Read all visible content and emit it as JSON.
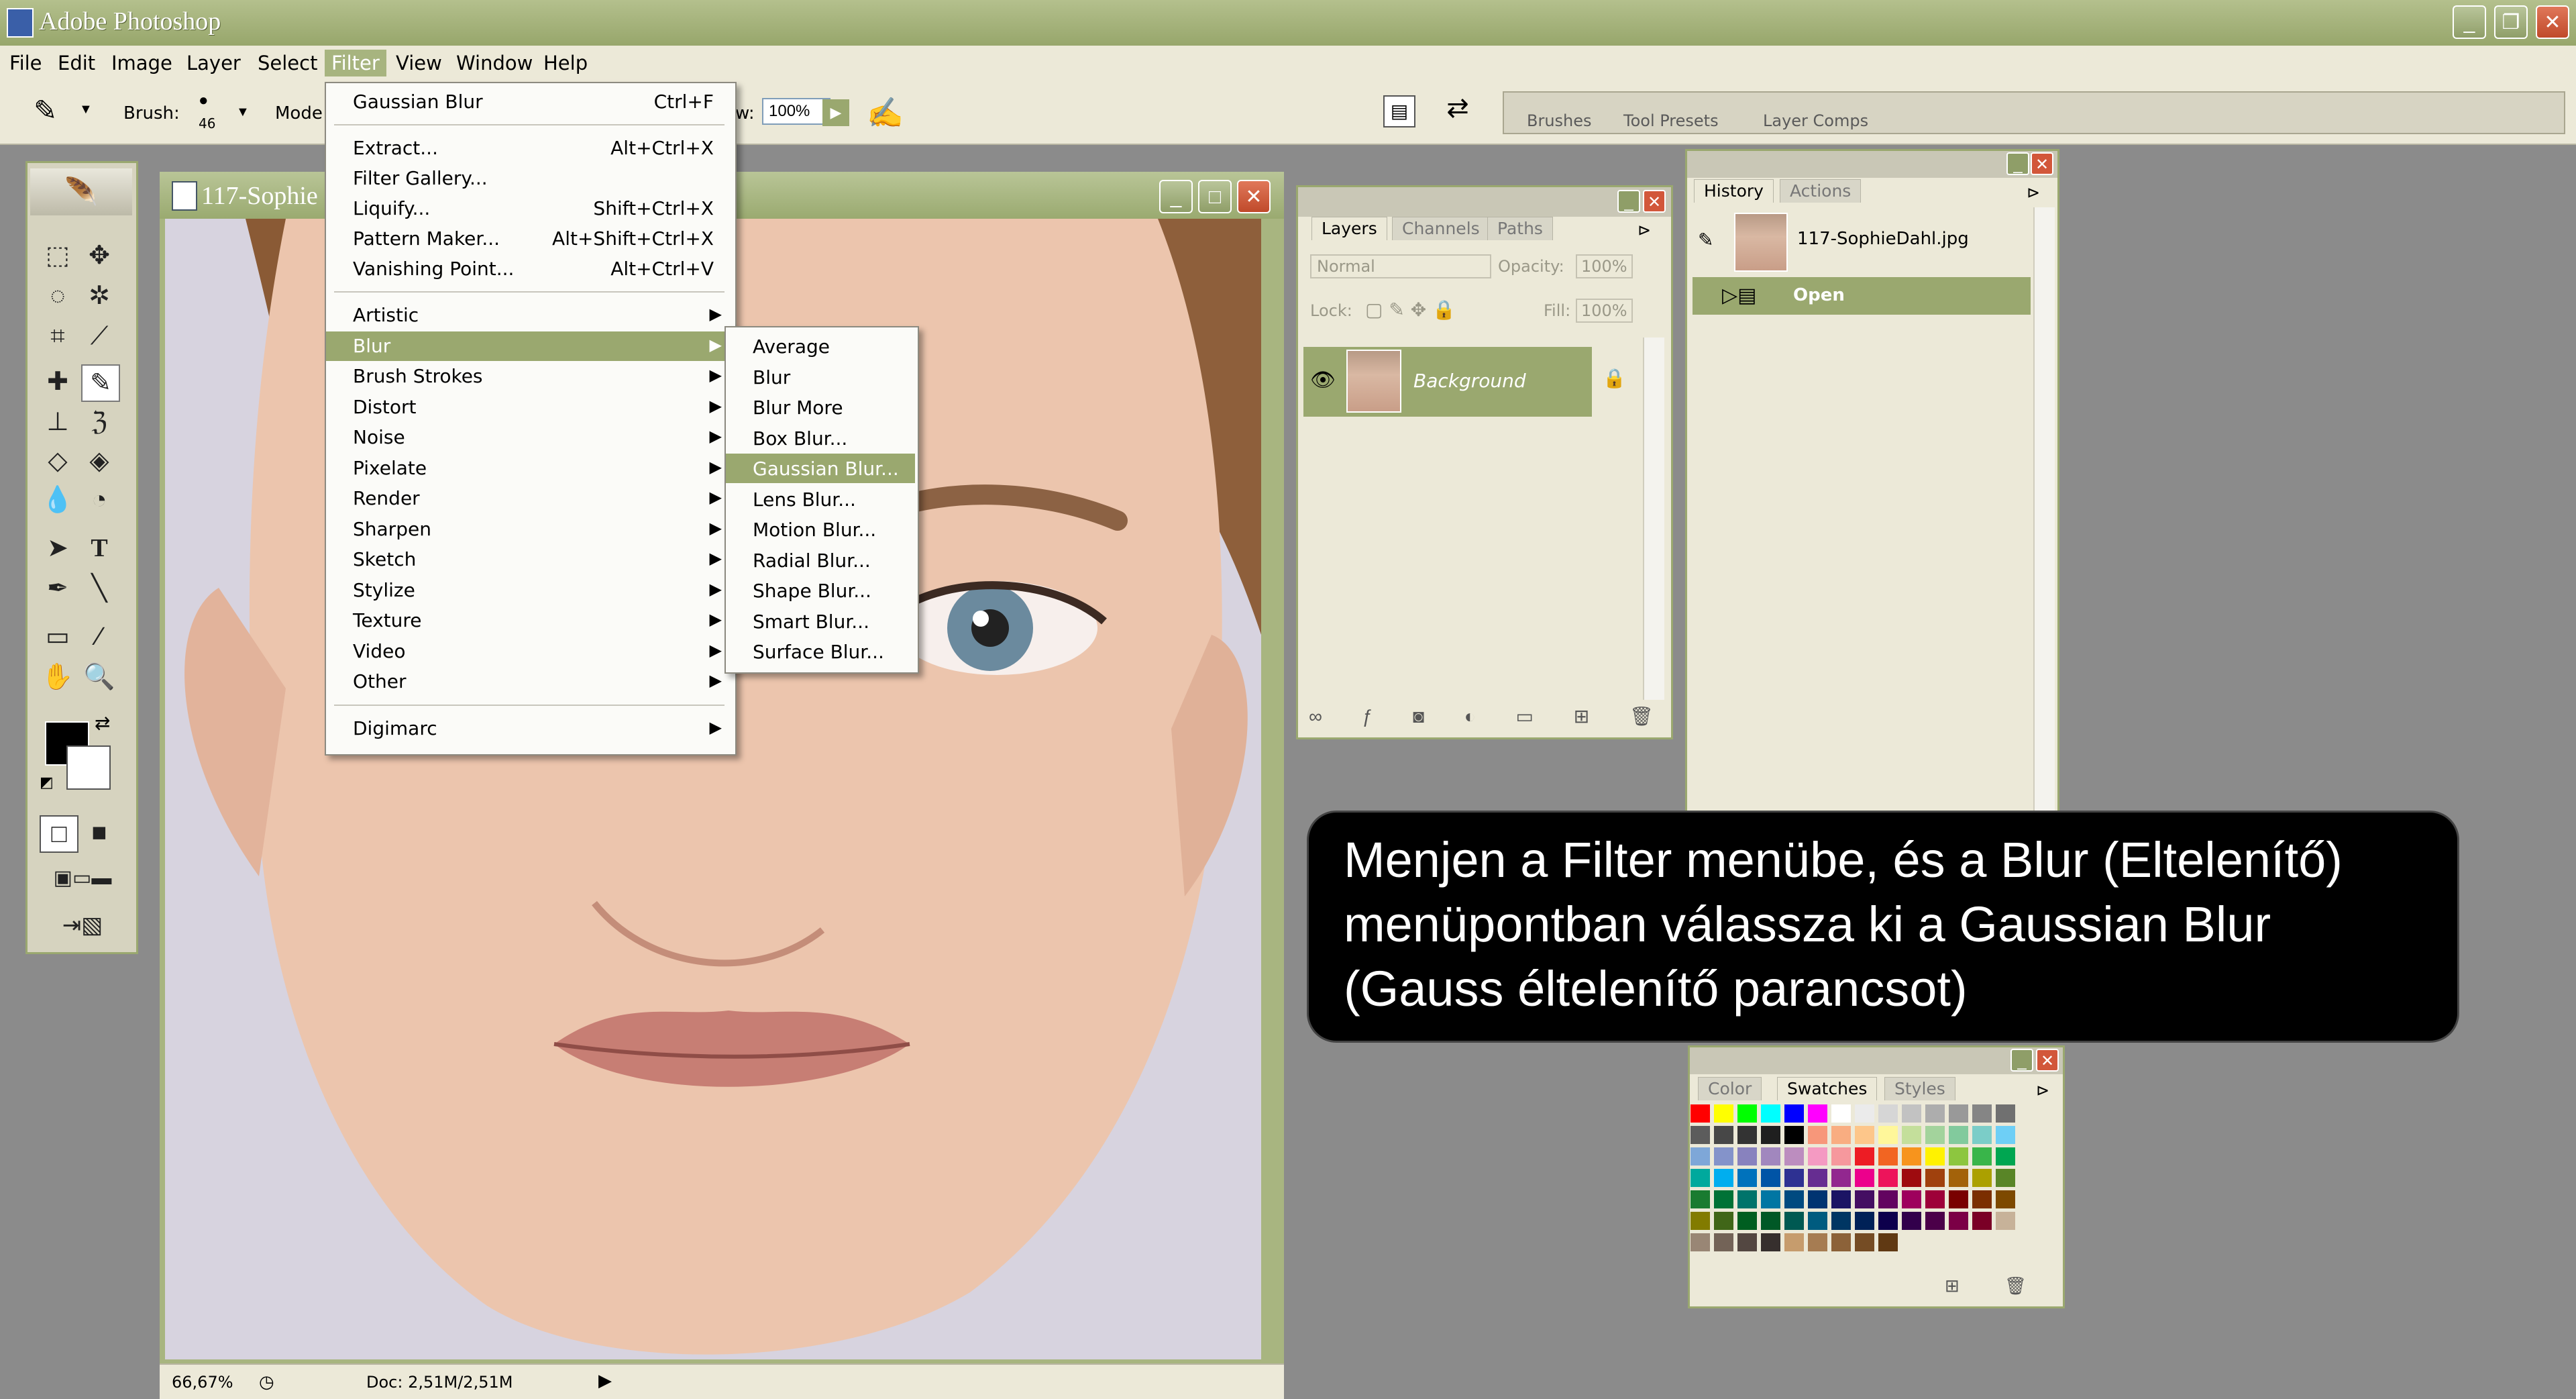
{
  "app": {
    "title": "Adobe Photoshop",
    "window_buttons": [
      "_",
      "❐",
      "✕"
    ]
  },
  "menubar": {
    "items": [
      "File",
      "Edit",
      "Image",
      "Layer",
      "Select",
      "Filter",
      "View",
      "Window",
      "Help"
    ],
    "active": "Filter"
  },
  "options_bar": {
    "brush_label": "Brush:",
    "brush_size": "46",
    "mode_label": "Mode",
    "flow_label": "w:",
    "flow_value": "100%",
    "palette_well_tabs": [
      "Brushes",
      "Tool Presets",
      "Layer Comps"
    ]
  },
  "filter_menu": {
    "top_items": [
      {
        "label": "Gaussian Blur",
        "shortcut": "Ctrl+F"
      }
    ],
    "group2": [
      {
        "label": "Extract...",
        "shortcut": "Alt+Ctrl+X"
      },
      {
        "label": "Filter Gallery...",
        "shortcut": ""
      },
      {
        "label": "Liquify...",
        "shortcut": "Shift+Ctrl+X"
      },
      {
        "label": "Pattern Maker...",
        "shortcut": "Alt+Shift+Ctrl+X"
      },
      {
        "label": "Vanishing Point...",
        "shortcut": "Alt+Ctrl+V"
      }
    ],
    "submenus": [
      "Artistic",
      "Blur",
      "Brush Strokes",
      "Distort",
      "Noise",
      "Pixelate",
      "Render",
      "Sharpen",
      "Sketch",
      "Stylize",
      "Texture",
      "Video",
      "Other"
    ],
    "highlighted": "Blur",
    "last": "Digimarc"
  },
  "blur_submenu": {
    "items": [
      "Average",
      "Blur",
      "Blur More",
      "Box Blur...",
      "Gaussian Blur...",
      "Lens Blur...",
      "Motion Blur...",
      "Radial Blur...",
      "Shape Blur...",
      "Smart Blur...",
      "Surface Blur..."
    ],
    "highlighted": "Gaussian Blur..."
  },
  "document": {
    "title": "117-Sophie",
    "zoom": "66,67%",
    "doc_info": "Doc: 2,51M/2,51M"
  },
  "layers_palette": {
    "tabs": [
      "Layers",
      "Channels",
      "Paths"
    ],
    "active_tab": "Layers",
    "blend_mode": "Normal",
    "opacity_label": "Opacity:",
    "opacity_value": "100%",
    "lock_label": "Lock:",
    "fill_label": "Fill:",
    "fill_value": "100%",
    "layer_name": "Background"
  },
  "history_palette": {
    "tabs": [
      "History",
      "Actions"
    ],
    "active_tab": "History",
    "snapshot": "117-SophieDahl.jpg",
    "state": "Open"
  },
  "swatches_palette": {
    "tabs": [
      "Color",
      "Swatches",
      "Styles"
    ],
    "active_tab": "Swatches",
    "rows": [
      [
        "#ff0000",
        "#ffff00",
        "#00ff00",
        "#00ffff",
        "#0000ff",
        "#ff00ff",
        "#ffffff",
        "#ebebeb",
        "#d6d6d6",
        "#c2c2c2",
        "#adadad",
        "#999999",
        "#858585",
        "#707070"
      ],
      [
        "#5c5c5c",
        "#474747",
        "#333333",
        "#1f1f1f",
        "#000000",
        "#f7977a",
        "#f9ad81",
        "#fdc68a",
        "#fff79a",
        "#c4df9b",
        "#a3d39c",
        "#82ca9d",
        "#7bcdc8",
        "#6ecff6"
      ],
      [
        "#7ea7d8",
        "#8493ca",
        "#8882be",
        "#a187be",
        "#bc8dbf",
        "#f49ac2",
        "#f6989d",
        "#ed1c24",
        "#f26522",
        "#f7941d",
        "#fff200",
        "#8dc63f",
        "#39b54a",
        "#00a651"
      ],
      [
        "#00a99d",
        "#00aeef",
        "#0072bc",
        "#0054a6",
        "#2e3192",
        "#662d91",
        "#92278f",
        "#ec008c",
        "#ed145b",
        "#9e0b0f",
        "#a0410d",
        "#a3620a",
        "#aba000",
        "#598527"
      ],
      [
        "#197b30",
        "#007236",
        "#00746b",
        "#0076a3",
        "#004a80",
        "#003471",
        "#1b1464",
        "#440e62",
        "#630460",
        "#9e005d",
        "#9e0039",
        "#790000",
        "#7b2e00",
        "#7d4900"
      ],
      [
        "#827b00",
        "#406618",
        "#005e20",
        "#005826",
        "#005952",
        "#005b7f",
        "#003663",
        "#002157",
        "#0d004c",
        "#32004b",
        "#4b0049",
        "#7b0046",
        "#7a0026",
        "#c7b299"
      ],
      [
        "#998675",
        "#736357",
        "#534741",
        "#362f2d",
        "#c69c6d",
        "#a67c52",
        "#8c6239",
        "#754c24",
        "#603913"
      ]
    ]
  },
  "callout": {
    "lines": [
      "Menjen a Filter menübe, és a Blur (Eltelenítő)",
      "menüpontban válassza ki a Gaussian Blur",
      "(Gauss éltelenítő parancsot)"
    ]
  }
}
